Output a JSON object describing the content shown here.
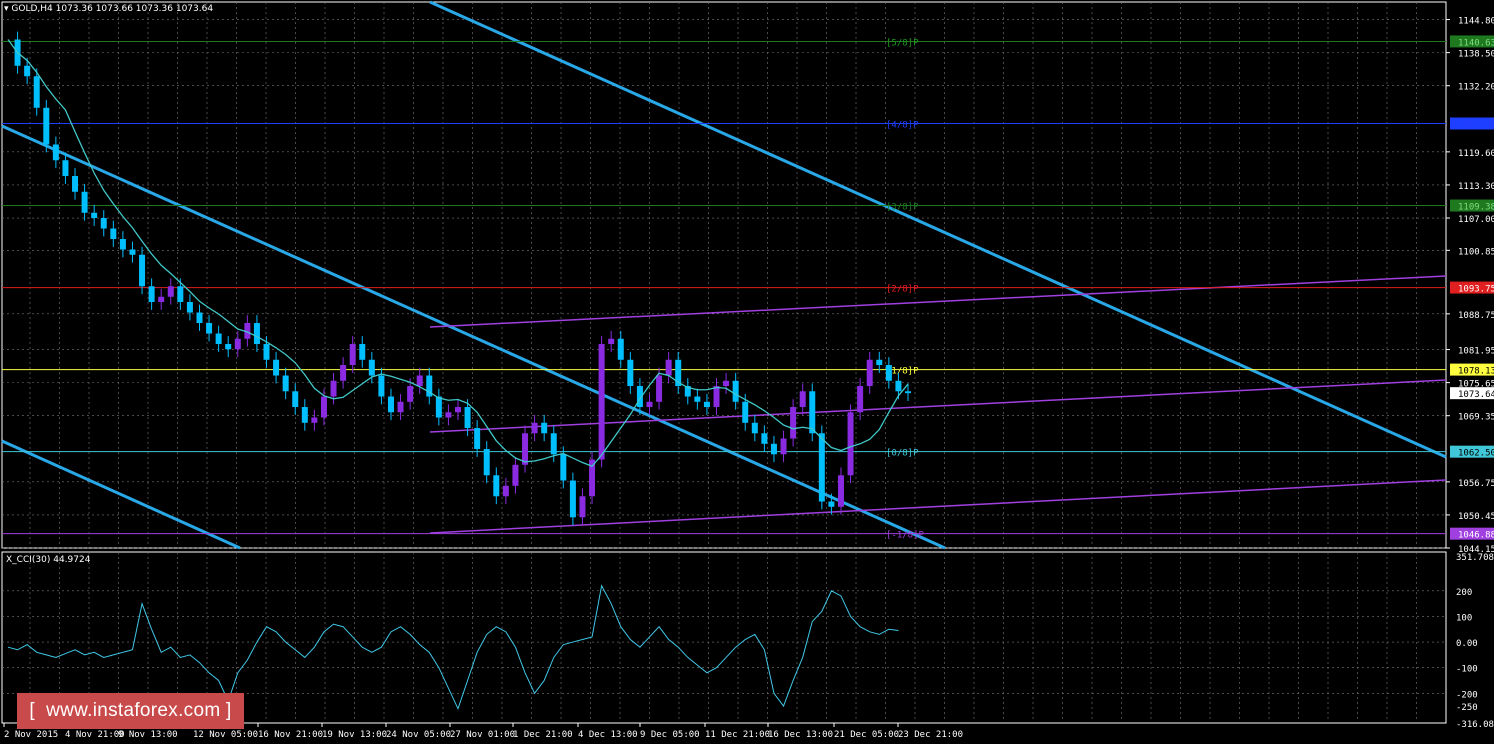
{
  "chart": {
    "symbol_header": "GOLD,H4  1073.36 1073.66 1073.36 1073.64",
    "indicator_header": "X_CCI(30) 44.9724",
    "current_price": "1073.64",
    "price_axis_labels": [
      "1144.80",
      "1138.50",
      "1132.20",
      "1119.60",
      "1113.30",
      "1107.00",
      "1100.85",
      "1088.75",
      "1081.95",
      "1075.65",
      "1069.35",
      "1056.75",
      "1050.45",
      "1044.15"
    ],
    "murrey_levels": [
      {
        "label": "[5/8]P",
        "price": "1140.63",
        "line_color": "#1f7a1f",
        "tag_bg": "#1f7a1f",
        "tag_fg": "#7ddc7d",
        "text_color": "#1f9a1f"
      },
      {
        "label": "[4/8]P",
        "price": "1125.00",
        "line_color": "#1f3fff",
        "tag_bg": "#1f3fff",
        "tag_fg": "#1f3fff",
        "text_color": "#1f3fff"
      },
      {
        "label": "[3/8]P",
        "price": "1109.38",
        "line_color": "#1f7a1f",
        "tag_bg": "#1f7a1f",
        "tag_fg": "#7ddc7d",
        "text_color": "#1f7a1f"
      },
      {
        "label": "[2/8]P",
        "price": "1093.75",
        "line_color": "#e02020",
        "tag_bg": "#e02020",
        "tag_fg": "#ffffff",
        "text_color": "#e02020"
      },
      {
        "label": "[1/8]P",
        "price": "1078.13",
        "line_color": "#ffff40",
        "tag_bg": "#ffff40",
        "tag_fg": "#000000",
        "text_color": "#ffff40"
      },
      {
        "label": "[0/8]P",
        "price": "1062.50",
        "line_color": "#40c8d8",
        "tag_bg": "#40c8d8",
        "tag_fg": "#000000",
        "text_color": "#40c8d8"
      },
      {
        "label": "[-1/8]P",
        "price": "1046.88",
        "line_color": "#a040e0",
        "tag_bg": "#a040e0",
        "tag_fg": "#ffffff",
        "text_color": "#a040e0"
      }
    ],
    "cci_axis_labels": [
      "351.7086",
      "200",
      "100",
      "0.00",
      "-100",
      "-200",
      "-250",
      "-316.0842"
    ],
    "time_axis_labels": [
      "2 Nov 2015",
      "4 Nov 21:00",
      "9 Nov 13:00",
      "12 Nov 05:00",
      "16 Nov 21:00",
      "19 Nov 13:00",
      "24 Nov 05:00",
      "27 Nov 01:00",
      "1 Dec 21:00",
      "4 Dec 13:00",
      "9 Dec 05:00",
      "11 Dec 21:00",
      "16 Dec 13:00",
      "21 Dec 05:00",
      "23 Dec 21:00"
    ],
    "colors": {
      "bull": "#8a2be2",
      "bear": "#00bfff",
      "ma": "#40c8c8",
      "cci": "#40c8e8",
      "trend_blue": "#29a8e8",
      "channel_purple": "#a040e0",
      "grid": "#7a7a7a",
      "axis": "#ffffff",
      "current_tag": "#ffffff"
    }
  },
  "chart_data": {
    "type": "line",
    "title": "GOLD,H4",
    "series": [
      {
        "name": "GOLD,H4",
        "values": [
          1141,
          1136,
          1134,
          1128,
          1121,
          1118,
          1115,
          1112,
          1108,
          1107,
          1105,
          1103,
          1101,
          1100,
          1094,
          1091,
          1092,
          1094,
          1091,
          1089,
          1087,
          1085,
          1083,
          1082,
          1084,
          1087,
          1083,
          1080,
          1077,
          1074,
          1071,
          1068,
          1069,
          1073,
          1076,
          1079,
          1083,
          1080,
          1077,
          1073,
          1070,
          1072,
          1075,
          1077,
          1073,
          1069,
          1070,
          1071,
          1067,
          1063,
          1058,
          1054,
          1056,
          1060,
          1066,
          1068,
          1066,
          1062,
          1057,
          1050,
          1054,
          1061,
          1083,
          1084,
          1080,
          1075,
          1071,
          1072,
          1077,
          1080,
          1075,
          1073,
          1072,
          1071,
          1075,
          1076,
          1072,
          1068,
          1066,
          1064,
          1062,
          1065,
          1071,
          1074,
          1066,
          1053,
          1052,
          1058,
          1070,
          1075,
          1080,
          1079,
          1076,
          1074,
          1073.64
        ]
      },
      {
        "name": "X_CCI(30)",
        "values": [
          -20,
          -30,
          -10,
          -40,
          -50,
          -60,
          -45,
          -30,
          -50,
          -40,
          -60,
          -50,
          -40,
          -30,
          150,
          50,
          -40,
          -20,
          -60,
          -50,
          -80,
          -120,
          -150,
          -230,
          -120,
          -70,
          0,
          60,
          40,
          0,
          -30,
          -60,
          -20,
          40,
          70,
          60,
          20,
          -20,
          -40,
          -20,
          40,
          60,
          30,
          -10,
          -40,
          -100,
          -180,
          -260,
          -150,
          -40,
          30,
          60,
          40,
          -20,
          -120,
          -200,
          -150,
          -60,
          -10,
          0,
          10,
          20,
          220,
          150,
          60,
          10,
          -20,
          20,
          60,
          10,
          -20,
          -60,
          -90,
          -120,
          -100,
          -60,
          -20,
          10,
          30,
          -30,
          -200,
          -250,
          -150,
          -60,
          80,
          120,
          200,
          180,
          100,
          60,
          40,
          30,
          50,
          45
        ]
      }
    ]
  }
}
